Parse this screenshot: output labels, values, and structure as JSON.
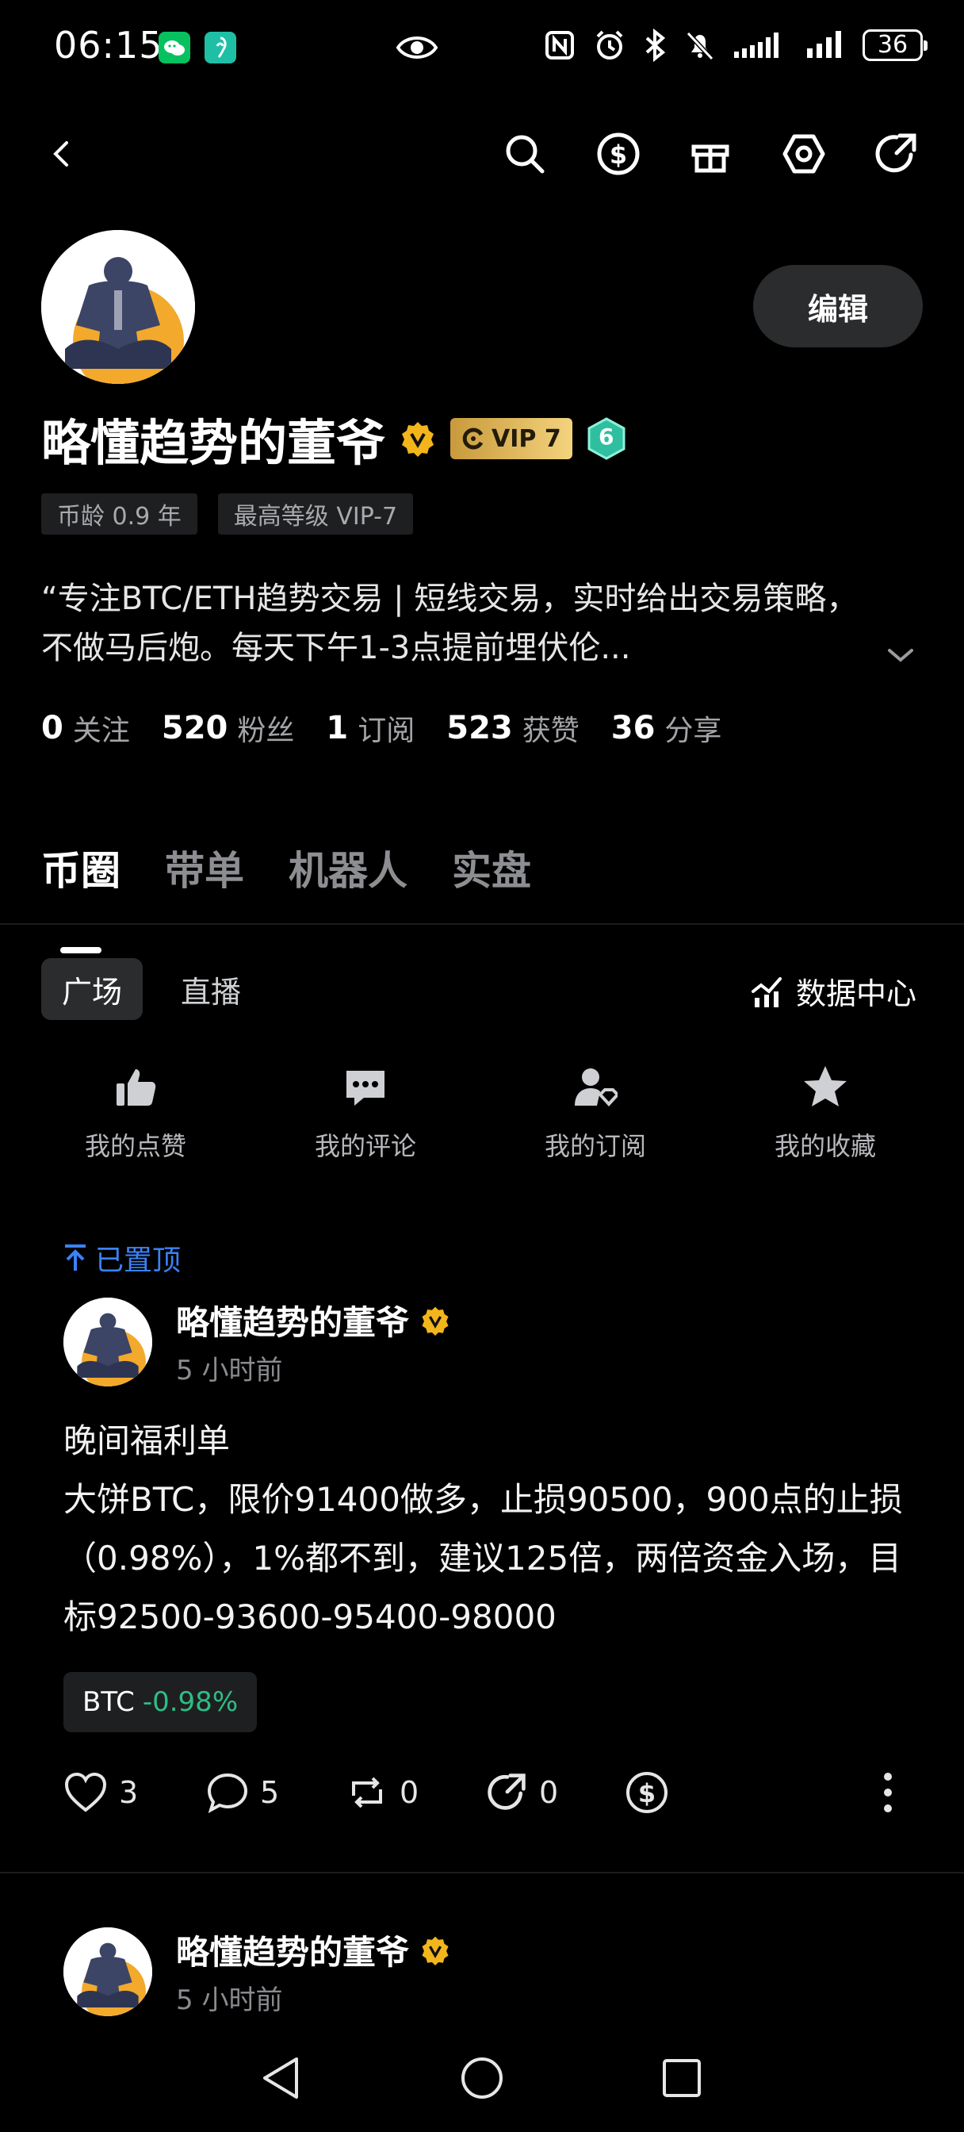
{
  "status_bar": {
    "time": "06:15",
    "battery": "36",
    "icons": [
      "wechat-icon",
      "app-icon",
      "eye-icon",
      "nfc-icon",
      "alarm-icon",
      "bluetooth-icon",
      "mute-icon",
      "signal-icon",
      "signal-icon-2",
      "battery-icon"
    ]
  },
  "top_nav": {
    "icons": [
      "back-icon",
      "search-icon",
      "dollar-icon",
      "gift-icon",
      "settings-icon",
      "share-icon"
    ]
  },
  "profile": {
    "edit_label": "编辑",
    "name": "略懂趋势的董爷",
    "vip_label": "VIP 7",
    "level": "6",
    "tags": [
      "币龄 0.9 年",
      "最高等级 VIP-7"
    ],
    "bio": "“专注BTC/ETH趋势交易 | 短线交易，实时给出交易策略，不做马后炮。每天下午1-3点提前埋伏伦...",
    "stats": [
      {
        "num": "0",
        "label": "关注"
      },
      {
        "num": "520",
        "label": "粉丝"
      },
      {
        "num": "1",
        "label": "订阅"
      },
      {
        "num": "523",
        "label": "获赞"
      },
      {
        "num": "36",
        "label": "分享"
      }
    ]
  },
  "tabs": [
    "币圈",
    "带单",
    "机器人",
    "实盘"
  ],
  "subtabs": [
    "广场",
    "直播"
  ],
  "data_center_label": "数据中心",
  "quick_actions": [
    {
      "label": "我的点赞",
      "icon": "thumbs-up-icon"
    },
    {
      "label": "我的评论",
      "icon": "comment-icon"
    },
    {
      "label": "我的订阅",
      "icon": "subscribe-icon"
    },
    {
      "label": "我的收藏",
      "icon": "star-icon"
    }
  ],
  "posts": [
    {
      "pinned_label": "已置顶",
      "author": "略懂趋势的董爷",
      "time": "5 小时前",
      "title": "晚间福利单",
      "body": "大饼BTC，限价91400做多，止损90500，900点的止损（0.98%），1%都不到，建议125倍，两倍资金入场，目标92500-93600-95400-98000",
      "coin": "BTC",
      "coin_change": "-0.98%",
      "likes": "3",
      "comments": "5",
      "reposts": "0",
      "shares": "0"
    },
    {
      "author": "略懂趋势的董爷",
      "time": "5 小时前"
    }
  ],
  "colors": {
    "background": "#000000",
    "accent_blue": "#3b82f6",
    "positive_green": "#2ebd85",
    "vip_gold": "#e3bb5c",
    "level_teal": "#2fbfa0"
  }
}
